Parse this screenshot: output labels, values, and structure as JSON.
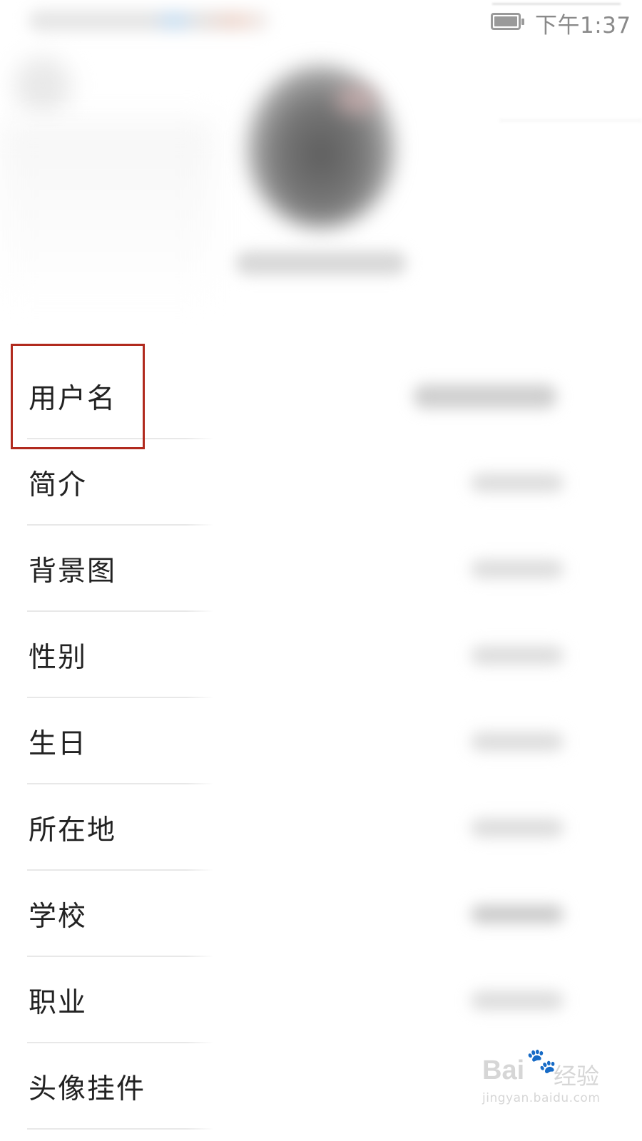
{
  "status_bar": {
    "time": "下午1:37",
    "battery_icon": "battery-icon"
  },
  "profile_fields": [
    {
      "label": "用户名"
    },
    {
      "label": "简介"
    },
    {
      "label": "背景图"
    },
    {
      "label": "性别"
    },
    {
      "label": "生日"
    },
    {
      "label": "所在地"
    },
    {
      "label": "学校"
    },
    {
      "label": "职业"
    },
    {
      "label": "头像挂件"
    }
  ],
  "annotation": {
    "highlight_color": "#b12a1e"
  },
  "watermark": {
    "brand": "Bai",
    "brand_suffix": "经验",
    "url": "jingyan.baidu.com",
    "icon": "paw-icon"
  }
}
